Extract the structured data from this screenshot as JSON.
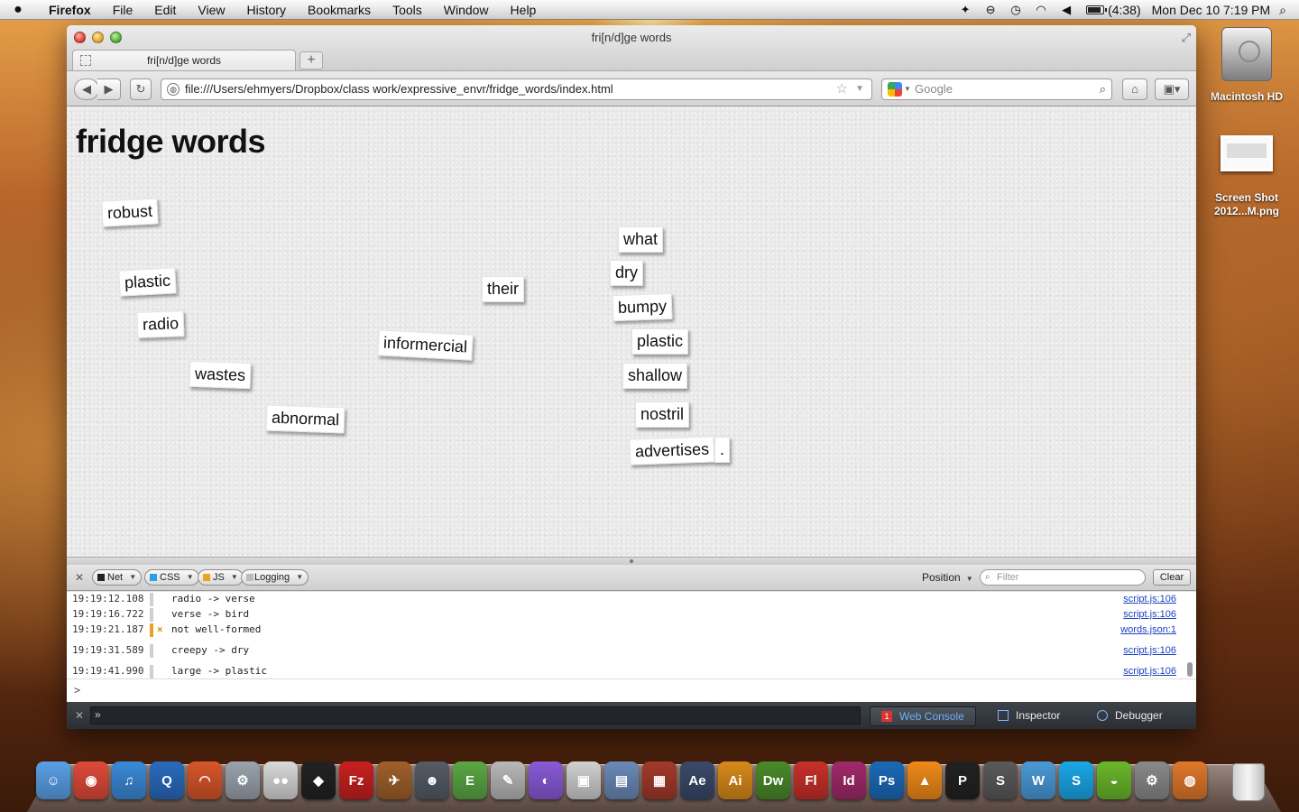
{
  "menubar": {
    "app_name": "Firefox",
    "menus": [
      "File",
      "Edit",
      "View",
      "History",
      "Bookmarks",
      "Tools",
      "Window",
      "Help"
    ],
    "battery_text": "(4:38)",
    "battery_level": 0.8,
    "clock": "Mon Dec 10  7:19 PM",
    "status_icons": [
      "dropbox-icon",
      "sync-icon",
      "time-machine-icon",
      "wifi-icon",
      "volume-icon",
      "battery-icon",
      "spotlight-icon"
    ]
  },
  "window": {
    "title": "fri[n/d]ge words",
    "tab_label": "fri[n/d]ge words",
    "new_tab": "+",
    "url": "file:///Users/ehmyers/Dropbox/class work/expressive_envr/fridge_words/index.html",
    "search_placeholder": "Google"
  },
  "page": {
    "heading": "fridge words",
    "magnets": [
      "robust",
      "plastic",
      "radio",
      "wastes",
      "abnormal",
      "informercial",
      "their",
      "what",
      "dry",
      "bumpy",
      "plastic",
      "shallow",
      "nostril",
      "advertises",
      "."
    ]
  },
  "console": {
    "filters": [
      "Net",
      "CSS",
      "JS",
      "Logging"
    ],
    "filter_colors": [
      "#222222",
      "#2aa1e0",
      "#f0a020"
    ],
    "position_label": "Position",
    "filter_placeholder": "Filter",
    "clear_label": "Clear",
    "log": [
      {
        "time": "19:19:12.108",
        "msg": "radio -> verse",
        "src": "script.js:106",
        "level": "log"
      },
      {
        "time": "19:19:16.722",
        "msg": "verse -> bird",
        "src": "script.js:106",
        "level": "log"
      },
      {
        "time": "19:19:21.187",
        "msg": "not well-formed",
        "src": "words.json:1",
        "level": "warn"
      },
      {
        "time": "19:19:31.589",
        "msg": "creepy -> dry",
        "src": "script.js:106",
        "level": "log"
      },
      {
        "time": "19:19:41.990",
        "msg": "large -> plastic",
        "src": "script.js:106",
        "level": "log"
      }
    ],
    "prompt": ">",
    "warn_mark": "×"
  },
  "devtools": {
    "gcli_prompt": "»",
    "tabs": [
      "Web Console",
      "Inspector",
      "Debugger"
    ],
    "webconsole_badge": "1"
  },
  "desktop": {
    "hd_label": "Macintosh HD",
    "screenshot_label": "Screen Shot 2012...M.png"
  },
  "dock": {
    "items": [
      {
        "name": "finder-icon",
        "color": "#5aa0e6",
        "glyph": "☺"
      },
      {
        "name": "chrome-icon",
        "color": "#e04a3a",
        "glyph": "◉"
      },
      {
        "name": "itunes-icon",
        "color": "#3a8ad8",
        "glyph": "♫"
      },
      {
        "name": "quicktime-icon",
        "color": "#2a6bbf",
        "glyph": "Q"
      },
      {
        "name": "audacity-icon",
        "color": "#d7562a",
        "glyph": "◠"
      },
      {
        "name": "automator-icon",
        "color": "#9aa3ad",
        "glyph": "⚙"
      },
      {
        "name": "cyberduck-eyes-icon",
        "color": "#d9d9d9",
        "glyph": "●●"
      },
      {
        "name": "growl-icon",
        "color": "#222222",
        "glyph": "◆"
      },
      {
        "name": "filezilla-icon",
        "color": "#c8201f",
        "glyph": "Fz"
      },
      {
        "name": "transmit-icon",
        "color": "#a0602a",
        "glyph": "✈"
      },
      {
        "name": "github-icon",
        "color": "#555c66",
        "glyph": "☻"
      },
      {
        "name": "evernote-icon",
        "color": "#5aa844",
        "glyph": "E"
      },
      {
        "name": "script-editor-icon",
        "color": "#b8b8b8",
        "glyph": "✎"
      },
      {
        "name": "color-picker-icon",
        "color": "#8a5ad8",
        "glyph": "◐"
      },
      {
        "name": "image-capture-icon",
        "color": "#d0d0d0",
        "glyph": "▣"
      },
      {
        "name": "preview-icon",
        "color": "#6a8ab8",
        "glyph": "▤"
      },
      {
        "name": "pdf-icon",
        "color": "#a33a2a",
        "glyph": "▦"
      },
      {
        "name": "after-effects-icon",
        "color": "#3a4a6a",
        "glyph": "Ae"
      },
      {
        "name": "illustrator-icon",
        "color": "#d88a1a",
        "glyph": "Ai"
      },
      {
        "name": "dreamweaver-icon",
        "color": "#4a8a2a",
        "glyph": "Dw"
      },
      {
        "name": "flash-icon",
        "color": "#c8302a",
        "glyph": "Fl"
      },
      {
        "name": "indesign-icon",
        "color": "#a02a6a",
        "glyph": "Id"
      },
      {
        "name": "photoshop-icon",
        "color": "#1a6ab8",
        "glyph": "Ps"
      },
      {
        "name": "vlc-icon",
        "color": "#f08a1a",
        "glyph": "▲"
      },
      {
        "name": "p-app-icon",
        "color": "#222222",
        "glyph": "P"
      },
      {
        "name": "sublime-icon",
        "color": "#5a5a5a",
        "glyph": "S"
      },
      {
        "name": "wunderlist-icon",
        "color": "#4a9ad8",
        "glyph": "W"
      },
      {
        "name": "skype-icon",
        "color": "#1aa8e8",
        "glyph": "S"
      },
      {
        "name": "android-icon",
        "color": "#6ab82a",
        "glyph": "◒"
      },
      {
        "name": "system-prefs-icon",
        "color": "#8a8a8a",
        "glyph": "⚙"
      },
      {
        "name": "firefox-icon",
        "color": "#e0782a",
        "glyph": "◍"
      }
    ]
  }
}
